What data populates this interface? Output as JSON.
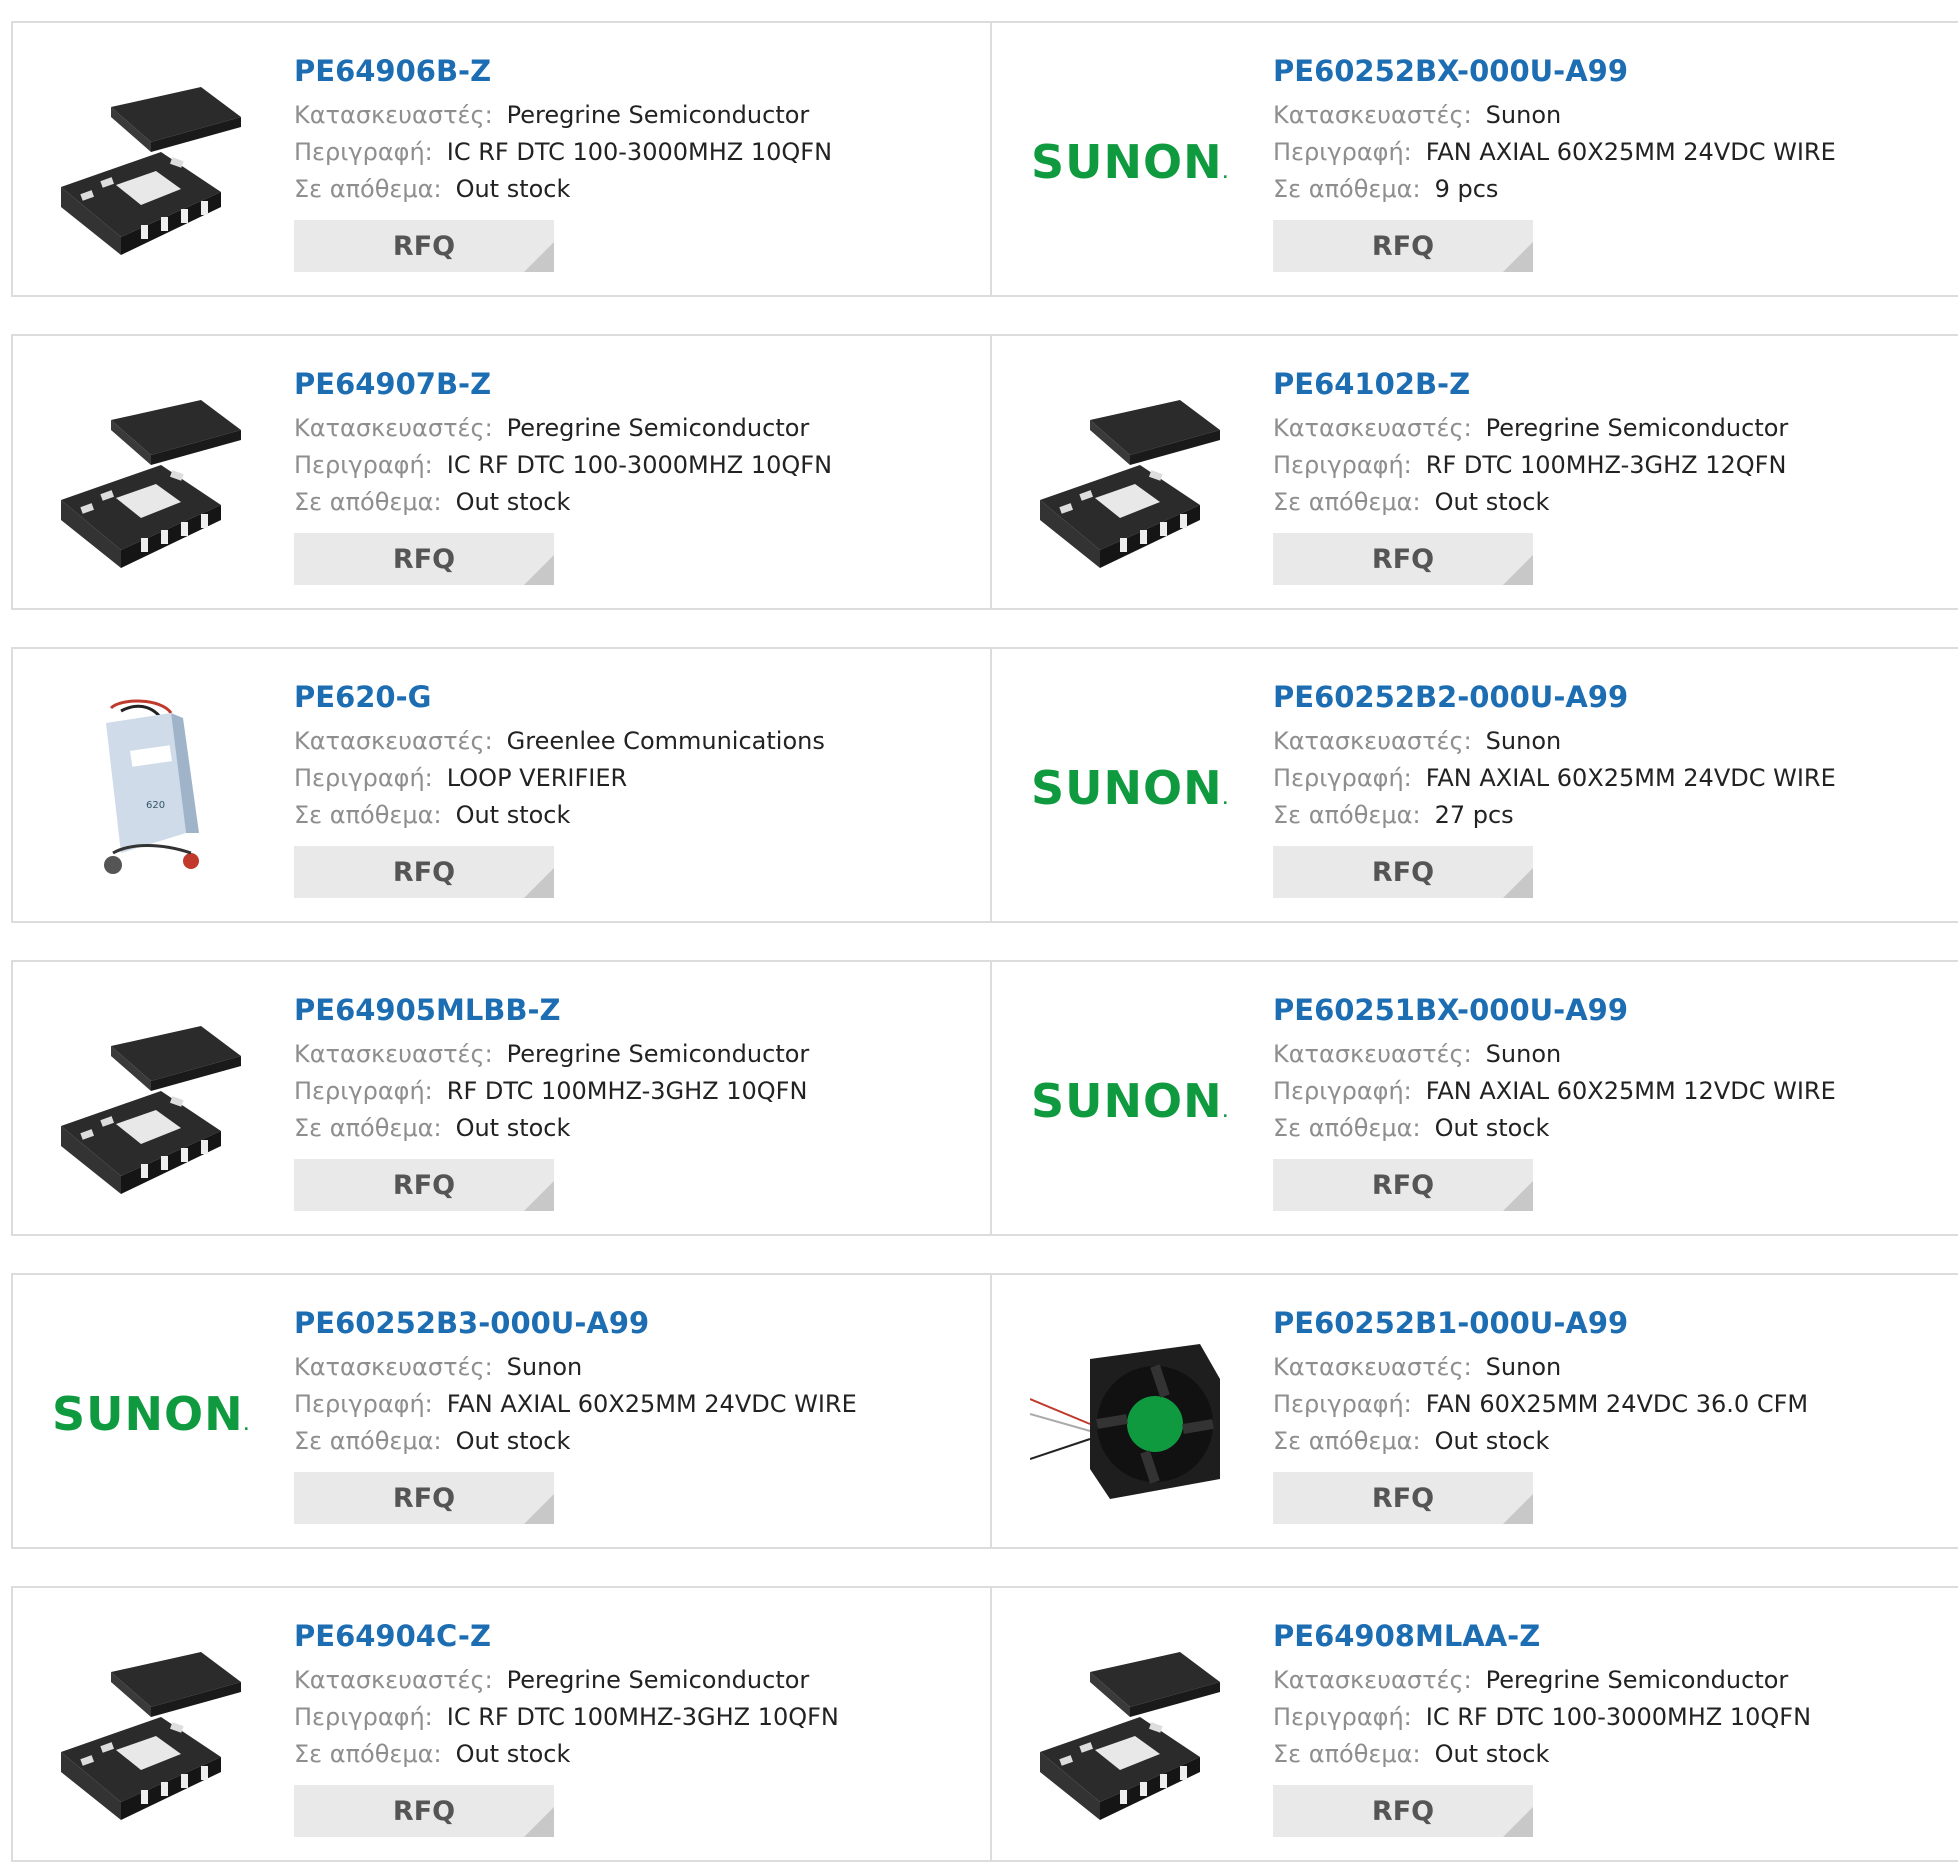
{
  "labels": {
    "manufacturer": "Κατασκευαστές:",
    "description": "Περιγραφή:",
    "stock": "Σε απόθεμα:",
    "rfq": "RFQ",
    "sunon_logo": "SUNON"
  },
  "colors": {
    "link": "#1d6db3",
    "sunon_green": "#0f9a3f",
    "button_bg": "#e9e9e9",
    "border": "#dcdcdc"
  },
  "rows": [
    [
      {
        "part": "PE64906B-Z",
        "manufacturer": "Peregrine Semiconductor",
        "description": "IC RF DTC 100-3000MHZ 10QFN",
        "stock": "Out stock",
        "image": "qfn-chip-icon"
      },
      {
        "part": "PE60252BX-000U-A99",
        "manufacturer": "Sunon",
        "description": "FAN AXIAL 60X25MM 24VDC WIRE",
        "stock": "9 pcs",
        "image": "sunon-logo"
      }
    ],
    [
      {
        "part": "PE64907B-Z",
        "manufacturer": "Peregrine Semiconductor",
        "description": "IC RF DTC 100-3000MHZ 10QFN",
        "stock": "Out stock",
        "image": "qfn-chip-icon"
      },
      {
        "part": "PE64102B-Z",
        "manufacturer": "Peregrine Semiconductor",
        "description": "RF DTC 100MHZ-3GHZ 12QFN",
        "stock": "Out stock",
        "image": "qfn-chip-icon"
      }
    ],
    [
      {
        "part": "PE620-G",
        "manufacturer": "Greenlee Communications",
        "description": "LOOP VERIFIER",
        "stock": "Out stock",
        "image": "loop-verifier-icon"
      },
      {
        "part": "PE60252B2-000U-A99",
        "manufacturer": "Sunon",
        "description": "FAN AXIAL 60X25MM 24VDC WIRE",
        "stock": "27 pcs",
        "image": "sunon-logo"
      }
    ],
    [
      {
        "part": "PE64905MLBB-Z",
        "manufacturer": "Peregrine Semiconductor",
        "description": "RF DTC 100MHZ-3GHZ 10QFN",
        "stock": "Out stock",
        "image": "qfn-chip-icon"
      },
      {
        "part": "PE60251BX-000U-A99",
        "manufacturer": "Sunon",
        "description": "FAN AXIAL 60X25MM 12VDC WIRE",
        "stock": "Out stock",
        "image": "sunon-logo"
      }
    ],
    [
      {
        "part": "PE60252B3-000U-A99",
        "manufacturer": "Sunon",
        "description": "FAN AXIAL 60X25MM 24VDC WIRE",
        "stock": "Out stock",
        "image": "sunon-logo"
      },
      {
        "part": "PE60252B1-000U-A99",
        "manufacturer": "Sunon",
        "description": "FAN 60X25MM 24VDC 36.0 CFM",
        "stock": "Out stock",
        "image": "fan-photo-icon"
      }
    ],
    [
      {
        "part": "PE64904C-Z",
        "manufacturer": "Peregrine Semiconductor",
        "description": "IC RF DTC 100MHZ-3GHZ 10QFN",
        "stock": "Out stock",
        "image": "qfn-chip-icon"
      },
      {
        "part": "PE64908MLAA-Z",
        "manufacturer": "Peregrine Semiconductor",
        "description": "IC RF DTC 100-3000MHZ 10QFN",
        "stock": "Out stock",
        "image": "qfn-chip-icon"
      }
    ]
  ]
}
